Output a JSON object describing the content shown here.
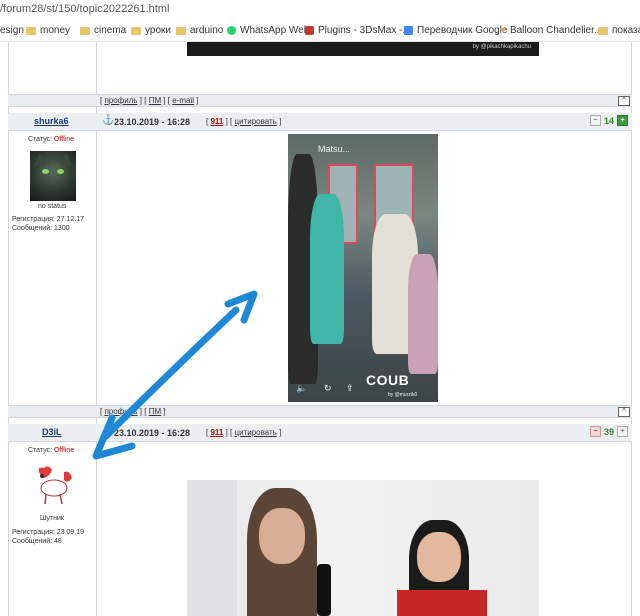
{
  "browser": {
    "url": "/forum28/st/150/topic2022261.html",
    "bookmarks": [
      {
        "label": "esign",
        "icon": "folder-icon"
      },
      {
        "label": "money",
        "icon": "folder-icon"
      },
      {
        "label": "cinema",
        "icon": "folder-icon"
      },
      {
        "label": "уроки",
        "icon": "folder-icon"
      },
      {
        "label": "arduino",
        "icon": "folder-icon"
      },
      {
        "label": "WhatsApp Web",
        "icon": "whatsapp-icon"
      },
      {
        "label": "Plugins - 3DsMax -...",
        "icon": "plugins-icon"
      },
      {
        "label": "Переводчик Google",
        "icon": "google-translate-icon"
      },
      {
        "label": "Balloon Chandelier...",
        "icon": "heart-icon"
      },
      {
        "label": "показа",
        "icon": "folder-icon"
      }
    ]
  },
  "top_image": {
    "credit": "by @pikachkapikachu"
  },
  "post_actions": {
    "profile": "профиль",
    "pm": "ПМ",
    "email": "e-mail"
  },
  "posts": [
    {
      "username": "shurka6",
      "date": "23.10.2019 - 16:28",
      "post_number": "911",
      "quote_label": "цитировать",
      "status_label": "Статус:",
      "status": "Offline",
      "avatar_caption": "no status",
      "registration": "Регистрация: 27.12.17",
      "messages": "Сообщений: 1300",
      "reputation": "14",
      "media": {
        "title": "Matsu...",
        "brand": "COUB",
        "credit": "by @murzik0"
      }
    },
    {
      "username": "D3iL",
      "date": "23.10.2019 - 16:28",
      "post_number": "911",
      "quote_label": "цитировать",
      "status_label": "Статус:",
      "status": "Offline",
      "avatar_caption": "Шутник",
      "registration": "Регистрация: 23.09.19",
      "messages": "Сообщений: 48",
      "reputation": "39"
    }
  ],
  "colors": {
    "annotation_arrow": "#1e88d6",
    "status_offline": "#cc0000",
    "post_number": "#bb0000"
  }
}
